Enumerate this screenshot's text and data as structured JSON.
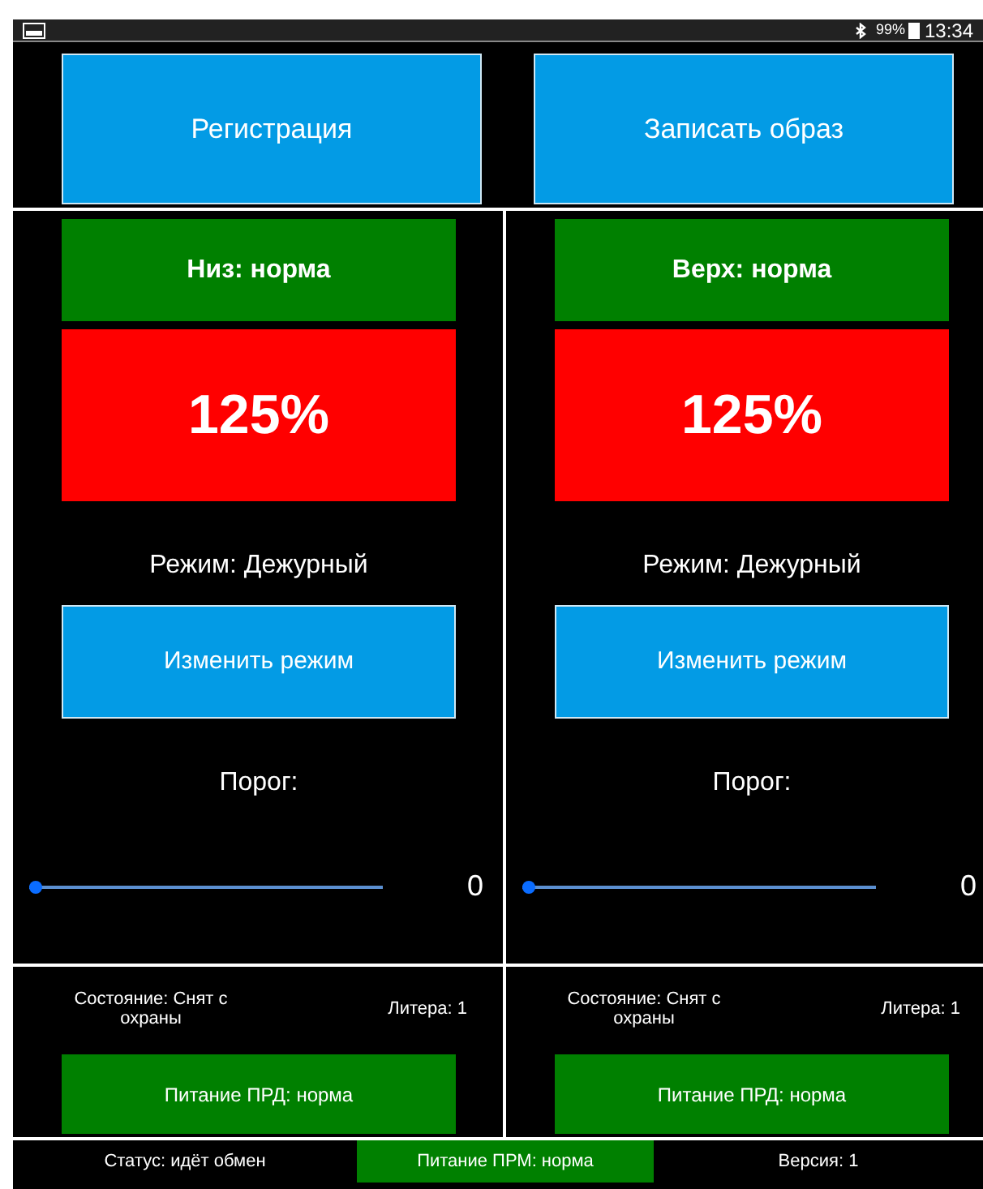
{
  "status_bar": {
    "battery": "99%",
    "time": "13:34"
  },
  "top_buttons": [
    "Регистрация",
    "Записать образ"
  ],
  "panels": [
    {
      "header": "Низ: норма",
      "percent": "125%",
      "mode": "Режим: Дежурный",
      "mode_button": "Изменить режим",
      "threshold_label": "Порог:",
      "threshold": {
        "level": 0,
        "reading": "0"
      },
      "state": "Состояние: Снят с охраны",
      "liter": "Литера: 1",
      "power": "Питание ПРД: норма"
    },
    {
      "header": "Верх: норма",
      "percent": "125%",
      "mode": "Режим: Дежурный",
      "mode_button": "Изменить режим",
      "threshold_label": "Порог:",
      "threshold": {
        "level": 0,
        "reading": "0"
      },
      "state": "Состояние: Снят с охраны",
      "liter": "Литера: 1",
      "power": "Питание ПРД: норма"
    }
  ],
  "footer": {
    "status": "Статус: идёт обмен",
    "power": "Питание ПРМ: норма",
    "version": "Версия: 1"
  }
}
